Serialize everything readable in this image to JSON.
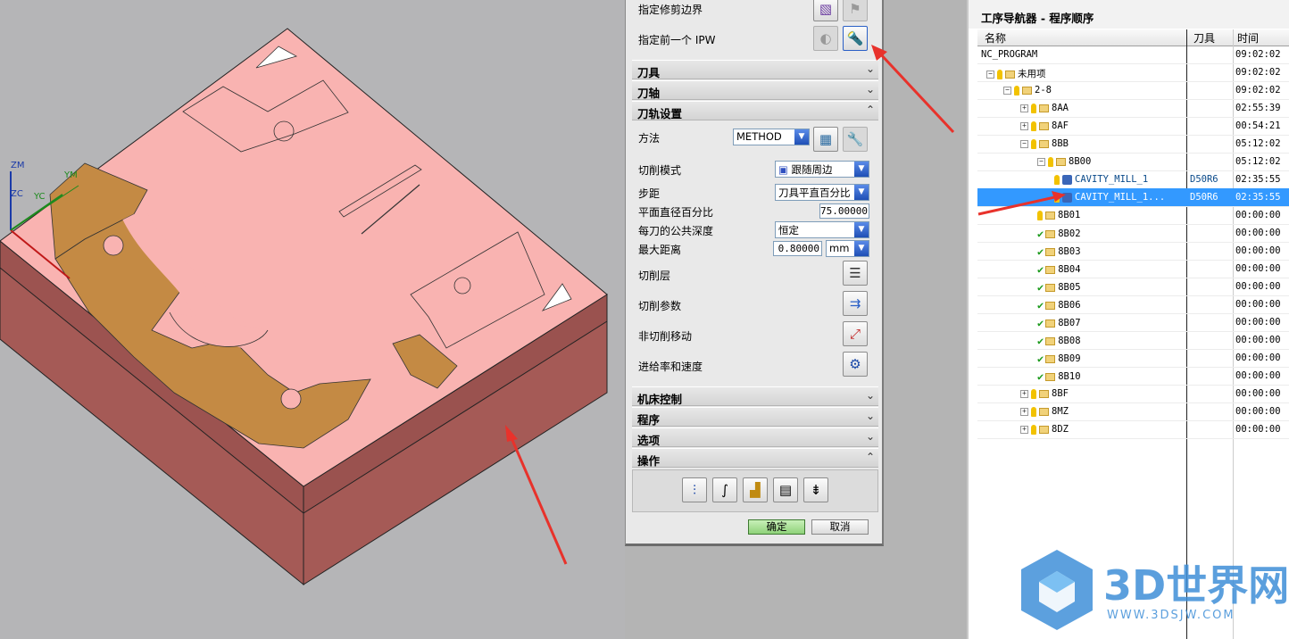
{
  "viewport": {
    "axes": {
      "zm": "ZM",
      "zc": "ZC",
      "yc": "YC",
      "ym": "YM"
    }
  },
  "dialog": {
    "trim_boundary_label": "指定修剪边界",
    "prev_ipw_label": "指定前一个 IPW",
    "sections": {
      "tool": "刀具",
      "axis": "刀轴",
      "path_settings": "刀轨设置",
      "machine_control": "机床控制",
      "program": "程序",
      "options": "选项",
      "actions": "操作"
    },
    "fields": {
      "method_label": "方法",
      "method_value": "METHOD",
      "cut_pattern_label": "切削模式",
      "cut_pattern_value": "跟随周边",
      "stepover_label": "步距",
      "stepover_value": "刀具平直百分比",
      "percent_label": "平面直径百分比",
      "percent_value": "75.00000",
      "depth_label": "每刀的公共深度",
      "depth_value": "恒定",
      "max_dist_label": "最大距离",
      "max_dist_value": "0.80000",
      "max_dist_unit": "mm",
      "cut_levels_label": "切削层",
      "cut_params_label": "切削参数",
      "non_cut_label": "非切削移动",
      "feeds_label": "进给率和速度"
    },
    "ok_label": "确定",
    "cancel_label": "取消"
  },
  "navigator": {
    "title": "工序导航器 - 程序顺序",
    "columns": {
      "name": "名称",
      "tool": "刀具",
      "time": "时间"
    },
    "rows": [
      {
        "name": "NC_PROGRAM",
        "tool": "",
        "time": "09:02:02"
      },
      {
        "name": "未用项",
        "tool": "",
        "time": "09:02:02"
      },
      {
        "name": "2-8",
        "tool": "",
        "time": "09:02:02"
      },
      {
        "name": "8AA",
        "tool": "",
        "time": "02:55:39"
      },
      {
        "name": "8AF",
        "tool": "",
        "time": "00:54:21"
      },
      {
        "name": "8BB",
        "tool": "",
        "time": "05:12:02"
      },
      {
        "name": "8B00",
        "tool": "",
        "time": "05:12:02"
      },
      {
        "name": "CAVITY_MILL_1",
        "tool": "D50R6",
        "time": "02:35:55"
      },
      {
        "name": "CAVITY_MILL_1...",
        "tool": "D50R6",
        "time": "02:35:55"
      },
      {
        "name": "8B01",
        "tool": "",
        "time": "00:00:00"
      },
      {
        "name": "8B02",
        "tool": "",
        "time": "00:00:00"
      },
      {
        "name": "8B03",
        "tool": "",
        "time": "00:00:00"
      },
      {
        "name": "8B04",
        "tool": "",
        "time": "00:00:00"
      },
      {
        "name": "8B05",
        "tool": "",
        "time": "00:00:00"
      },
      {
        "name": "8B06",
        "tool": "",
        "time": "00:00:00"
      },
      {
        "name": "8B07",
        "tool": "",
        "time": "00:00:00"
      },
      {
        "name": "8B08",
        "tool": "",
        "time": "00:00:00"
      },
      {
        "name": "8B09",
        "tool": "",
        "time": "00:00:00"
      },
      {
        "name": "8B10",
        "tool": "",
        "time": "00:00:00"
      },
      {
        "name": "8BF",
        "tool": "",
        "time": "00:00:00"
      },
      {
        "name": "8MZ",
        "tool": "",
        "time": "00:00:00"
      },
      {
        "name": "8DZ",
        "tool": "",
        "time": "00:00:00"
      }
    ]
  },
  "watermark": {
    "name": "3D世界网",
    "url": "WWW.3DSJW.COM"
  }
}
